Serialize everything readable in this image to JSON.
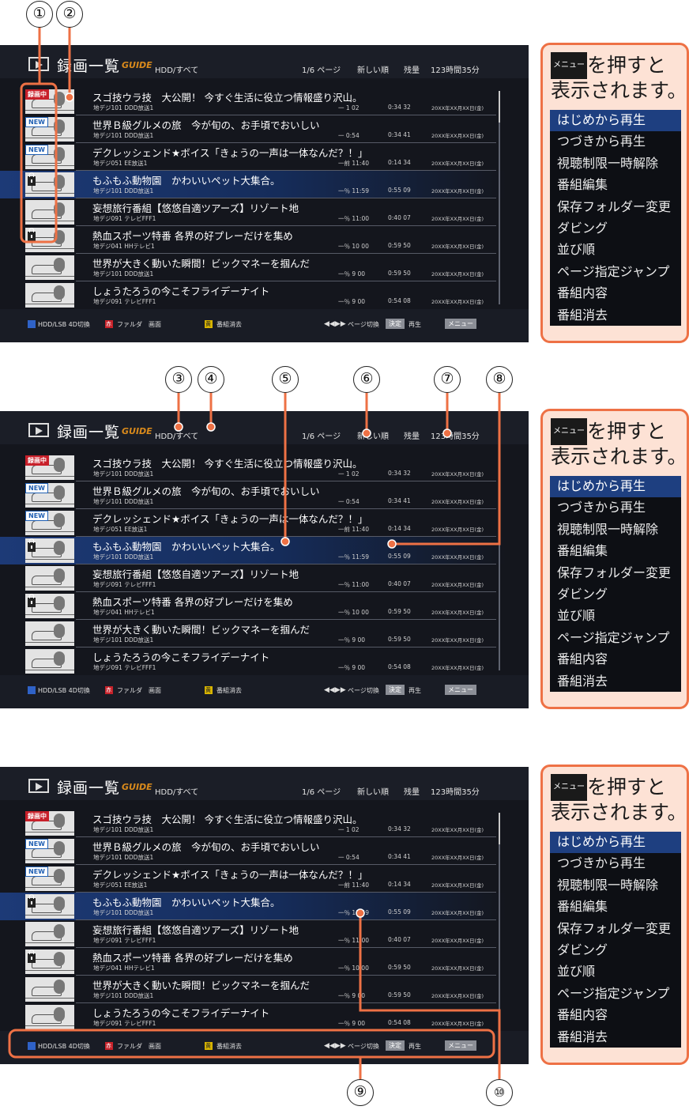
{
  "screen": {
    "title": "録画一覧",
    "guide_logo": "GUIDE",
    "source": "HDD/すべて",
    "page": "1/6 ページ",
    "sort": "新しい順",
    "remaining_label": "残量",
    "remaining": "123時間35分"
  },
  "programs": [
    {
      "title": "スゴ技ウラ技　大公開！ 今すぐ生活に役立つ情報盛り沢山。",
      "channel": "地デジ101 DDD放送1",
      "day": "一 1 02",
      "duration": "0:34 32",
      "date": "20XX年XX月XX日(金)",
      "badge": "録画中",
      "badge_type": "rec"
    },
    {
      "title": "世界Ｂ級グルメの旅　今が旬の、お手頃でおいしい",
      "channel": "地デジ101 DDD放送1",
      "day": "一 0:54",
      "duration": "0:34 41",
      "date": "20XX年XX月XX日(金)",
      "badge": "NEW",
      "badge_type": "new"
    },
    {
      "title": "デクレッシェンド★ボイス「きょうの一声は一体なんだ？！」",
      "channel": "地デジ051 EE放送1",
      "day": "一前 11:40",
      "duration": "0:14 34",
      "date": "20XX年XX月XX日(金)",
      "badge": "NEW",
      "badge_type": "new"
    },
    {
      "title": "もふもふ動物園　かわいいペット大集合。",
      "channel": "地デジ101 DDD放送1",
      "day": "一％ 11:59",
      "duration": "0:55 09",
      "date": "20XX年XX月XX日(金)",
      "badge": "",
      "badge_type": "lock"
    },
    {
      "title": "妄想旅行番組【悠悠自適ツアーズ】リゾート地",
      "channel": "地デジ091 テレビFFF1",
      "day": "一％ 11:00",
      "duration": "0:40 07",
      "date": "20XX年XX月XX日(金)",
      "badge": "",
      "badge_type": "none"
    },
    {
      "title": "熱血スポーツ特番 各界の好プレーだけを集め",
      "channel": "地デジ041 HHテレビ1",
      "day": "一％ 10 00",
      "duration": "0:59 50",
      "date": "20XX年XX月XX日(金)",
      "badge": "",
      "badge_type": "lock"
    },
    {
      "title": "世界が大きく動いた瞬間！ビックマネーを掴んだ",
      "channel": "地デジ101 DDD放送1",
      "day": "一％ 9 00",
      "duration": "0:59 50",
      "date": "20XX年XX月XX日(金)",
      "badge": "",
      "badge_type": "none"
    },
    {
      "title": "しょうたろうの今こそフライデーナイト",
      "channel": "地デジ091 テレビFFF1",
      "day": "一％ 9 00",
      "duration": "0:54 08",
      "date": "20XX年XX月XX日(金)",
      "badge": "",
      "badge_type": "none"
    }
  ],
  "footer": {
    "blue_label": "HDD/LSB 4D切換",
    "red_key": "赤",
    "red_label": "ファルダ　画面",
    "yellow_key": "黄",
    "yellow_label": "番組消去",
    "skip_label": "ページ切換",
    "ok_key": "決定",
    "ok_label": "再生",
    "menu_key": "メニュー"
  },
  "menu_panel": {
    "key": "メニュー",
    "line1": "を押すと",
    "line2": "表示されます。",
    "items": [
      "はじめから再生",
      "つづきから再生",
      "視聴制限一時解除",
      "番組編集",
      "保存フォルダー変更",
      "ダビング",
      "並び順",
      "ページ指定ジャンプ",
      "番組内容",
      "番組消去"
    ]
  },
  "callouts": [
    "①",
    "②",
    "③",
    "④",
    "⑤",
    "⑥",
    "⑦",
    "⑧",
    "⑨",
    "⑩"
  ],
  "colors": {
    "accent": "#ee7145",
    "selection": "#1e3f80",
    "screen_bg": "#14161d",
    "record_badge": "#c8202a"
  }
}
